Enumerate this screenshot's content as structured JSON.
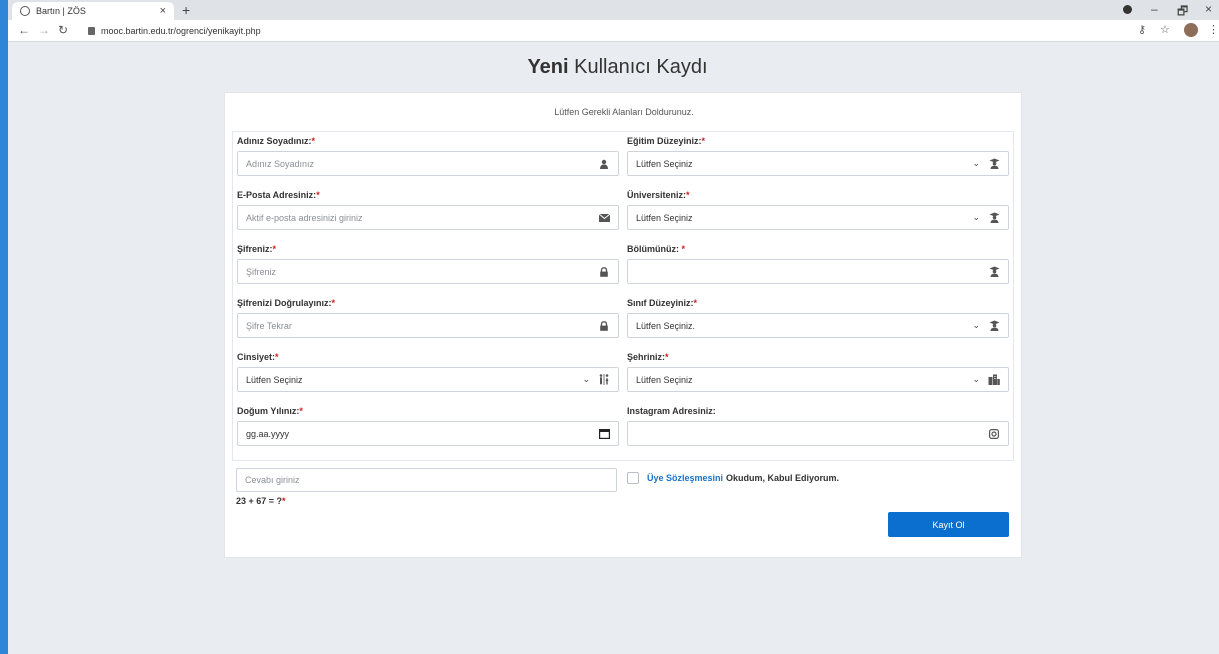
{
  "browser": {
    "tab_title": "Bartın | ZÖS",
    "tab_close": "×",
    "new_tab": "+",
    "url": "mooc.bartin.edu.tr/ogrenci/yenikayit.php",
    "window_min": "–",
    "window_restore": "🗗",
    "window_close": "×"
  },
  "page": {
    "title_bold": "Yeni",
    "title_rest": "Kullanıcı Kaydı",
    "subtitle": "Lütfen Gerekli Alanları Doldurunuz."
  },
  "form": {
    "left": [
      {
        "label": "Adınız Soyadınız:",
        "req": "*",
        "placeholder": "Adınız Soyadınız",
        "icon": "user-icon"
      },
      {
        "label": "E-Posta Adresiniz:",
        "req": "*",
        "placeholder": "Aktif e-posta adresinizi giriniz",
        "icon": "envelope-icon"
      },
      {
        "label": "Şifreniz:",
        "req": "*",
        "placeholder": "Şifreniz",
        "icon": "lock-icon"
      },
      {
        "label": "Şifrenizi Doğrulayınız:",
        "req": "*",
        "placeholder": "Şifre Tekrar",
        "icon": "lock-icon"
      },
      {
        "label": "Cinsiyet:",
        "req": "*",
        "value": "Lütfen Seçiniz",
        "icon": "gender-icon"
      },
      {
        "label": "Doğum Yılınız:",
        "req": "*",
        "value": "gg.aa.yyyy",
        "icon": "calendar-icon"
      }
    ],
    "right": [
      {
        "label": "Eğitim Düzeyiniz:",
        "req": "*",
        "value": "Lütfen Seçiniz",
        "icon": "graduate-icon"
      },
      {
        "label": "Üniversiteniz:",
        "req": "*",
        "value": "Lütfen Seçiniz",
        "icon": "graduate-icon"
      },
      {
        "label": "Bölümünüz: ",
        "req": "*",
        "value": "",
        "icon": "graduate-icon"
      },
      {
        "label": "Sınıf Düzeyiniz:",
        "req": "*",
        "value": "Lütfen Seçiniz.",
        "icon": "graduate-icon"
      },
      {
        "label": "Şehriniz:",
        "req": "*",
        "value": "Lütfen Seçiniz",
        "icon": "city-icon"
      },
      {
        "label": "Instagram Adresiniz:",
        "req": "",
        "value": "",
        "icon": "instagram-icon"
      }
    ],
    "captcha_placeholder": "Cevabı giriniz",
    "captcha_question": "23 + 67 = ?",
    "captcha_req": "*",
    "agree_link": "Üye Sözleşmesini",
    "agree_rest": "Okudum, Kabul Ediyorum.",
    "submit_label": "Kayıt Ol"
  }
}
